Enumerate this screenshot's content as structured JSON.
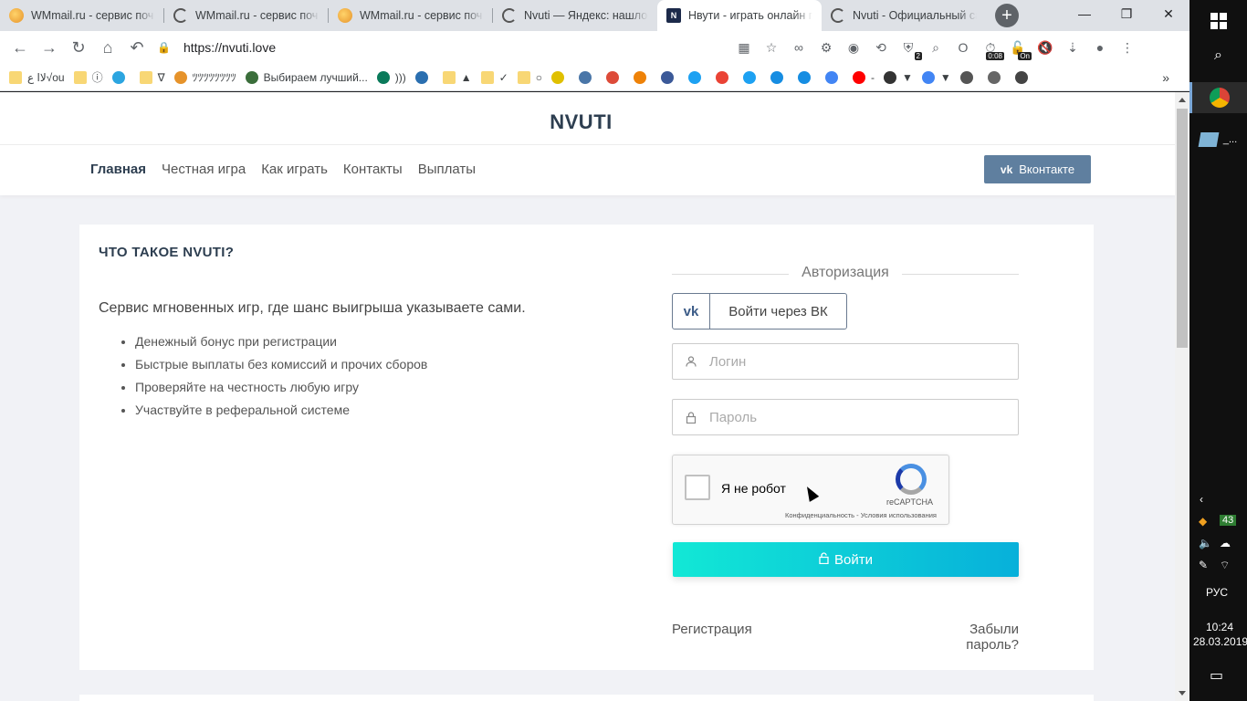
{
  "browser": {
    "tabs": [
      {
        "title": "WMmail.ru - сервис поч",
        "favicon": "wmmail-icon",
        "active": false
      },
      {
        "title": "WMmail.ru - сервис поч",
        "favicon": "loading-icon",
        "active": false
      },
      {
        "title": "WMmail.ru - сервис поч",
        "favicon": "wmmail-icon",
        "active": false
      },
      {
        "title": "Nvuti — Яндекс: нашлос",
        "favicon": "loading-icon",
        "active": false
      },
      {
        "title": "Нвути - играть онлайн п",
        "favicon": "nvuti-icon",
        "active": true
      },
      {
        "title": "Nvuti - Официальный са",
        "favicon": "loading-icon",
        "active": false
      }
    ],
    "new_tab": "+",
    "window_controls": {
      "minimize": "—",
      "restore": "❐",
      "close": "✕"
    },
    "nav": {
      "back": "←",
      "forward": "→",
      "reload": "↻",
      "home": "⌂",
      "undo": "↶"
    },
    "url": "https://nvuti.love",
    "extensions": [
      {
        "name": "qr-icon",
        "glyph": "▦"
      },
      {
        "name": "star-icon",
        "glyph": "☆"
      },
      {
        "name": "infinity-icon",
        "glyph": "∞"
      },
      {
        "name": "link-icon",
        "glyph": "⚙"
      },
      {
        "name": "steam-icon",
        "glyph": "◉"
      },
      {
        "name": "history-icon",
        "glyph": "⟲"
      },
      {
        "name": "shield-icon",
        "glyph": "⛨",
        "badge": "2"
      },
      {
        "name": "search-ext-icon",
        "glyph": "⌕"
      },
      {
        "name": "opera-icon",
        "glyph": "O"
      },
      {
        "name": "timer-icon",
        "glyph": "⏱",
        "badge": "0:08"
      },
      {
        "name": "vpn-icon",
        "glyph": "🔓",
        "badge": "On"
      },
      {
        "name": "mute-icon",
        "glyph": "🔇"
      },
      {
        "name": "download-icon",
        "glyph": "⇣"
      },
      {
        "name": "avatar-icon",
        "glyph": "●"
      },
      {
        "name": "menu-icon",
        "glyph": "⋮"
      }
    ]
  },
  "bookmarks": [
    {
      "label": "ﻻﺍ ع√ou",
      "icon": "folder-icon"
    },
    {
      "label": "ⓘ",
      "icon": "folder-icon"
    },
    {
      "label": "",
      "icon": "telegram-icon"
    },
    {
      "label": "∇",
      "icon": "folder-icon"
    },
    {
      "label": "ﾂﾂﾂﾂﾂﾂﾂﾂ",
      "icon": "wmmail-icon"
    },
    {
      "label": "Выбираем лучший...",
      "icon": "game-icon"
    },
    {
      "label": ")))",
      "icon": "globe-icon"
    },
    {
      "label": "",
      "icon": "mail-icon"
    },
    {
      "label": "▲",
      "icon": "folder-icon"
    },
    {
      "label": "✓",
      "icon": "folder-icon"
    },
    {
      "label": "○",
      "icon": "folder-icon"
    },
    {
      "label": "",
      "icon": "send-icon"
    },
    {
      "label": "",
      "icon": "vk-icon"
    },
    {
      "label": "",
      "icon": "google-plus-icon"
    },
    {
      "label": "",
      "icon": "odnoklassniki-icon"
    },
    {
      "label": "",
      "icon": "facebook-icon"
    },
    {
      "label": "",
      "icon": "twitter-icon"
    },
    {
      "label": "",
      "icon": "gmail-icon"
    },
    {
      "label": "",
      "icon": "twitter-icon"
    },
    {
      "label": "",
      "icon": "mailru-icon"
    },
    {
      "label": "",
      "icon": "mailru-icon"
    },
    {
      "label": "",
      "icon": "translate-icon"
    },
    {
      "label": "-",
      "icon": "youtube-icon"
    },
    {
      "label": "▼",
      "icon": "list-icon"
    },
    {
      "label": "▼",
      "icon": "docs-icon"
    },
    {
      "label": "",
      "icon": "barcode-icon"
    },
    {
      "label": "",
      "icon": "computer-icon"
    },
    {
      "label": "",
      "icon": "speed-icon"
    }
  ],
  "bookmarks_more": "»",
  "site": {
    "logo": "NVUTI",
    "menu": [
      "Главная",
      "Честная игра",
      "Как играть",
      "Контакты",
      "Выплаты"
    ],
    "vk_button": "Вконтакте",
    "vk_glyph": "vk",
    "info": {
      "title": "ЧТО ТАКОЕ NVUTI?",
      "description": "Сервис мгновенных игр, где шанс выигрыша указываете сами.",
      "features": [
        "Денежный бонус при регистрации",
        "Быстрые выплаты без комиссий и прочих сборов",
        "Проверяйте на честность любую игру",
        "Участвуйте в реферальной системе"
      ]
    },
    "auth": {
      "legend": "Авторизация",
      "vk_login": "Войти через ВК",
      "login_placeholder": "Логин",
      "password_placeholder": "Пароль",
      "recaptcha_label": "Я не робот",
      "recaptcha_brand": "reCAPTCHA",
      "recaptcha_terms": "Конфиденциальность - Условия использования",
      "submit": "Войти",
      "register": "Регистрация",
      "forgot": "Забыли пароль?"
    }
  },
  "taskbar": {
    "badge": "43",
    "language": "РУС",
    "time": "10:24",
    "date": "28.03.2019",
    "app_label": "_..."
  },
  "colors": {
    "accent_gradient_start": "#12e8d6",
    "accent_gradient_end": "#07b0da",
    "vk_button": "#5f7f9f",
    "heading": "#2d3e50"
  }
}
